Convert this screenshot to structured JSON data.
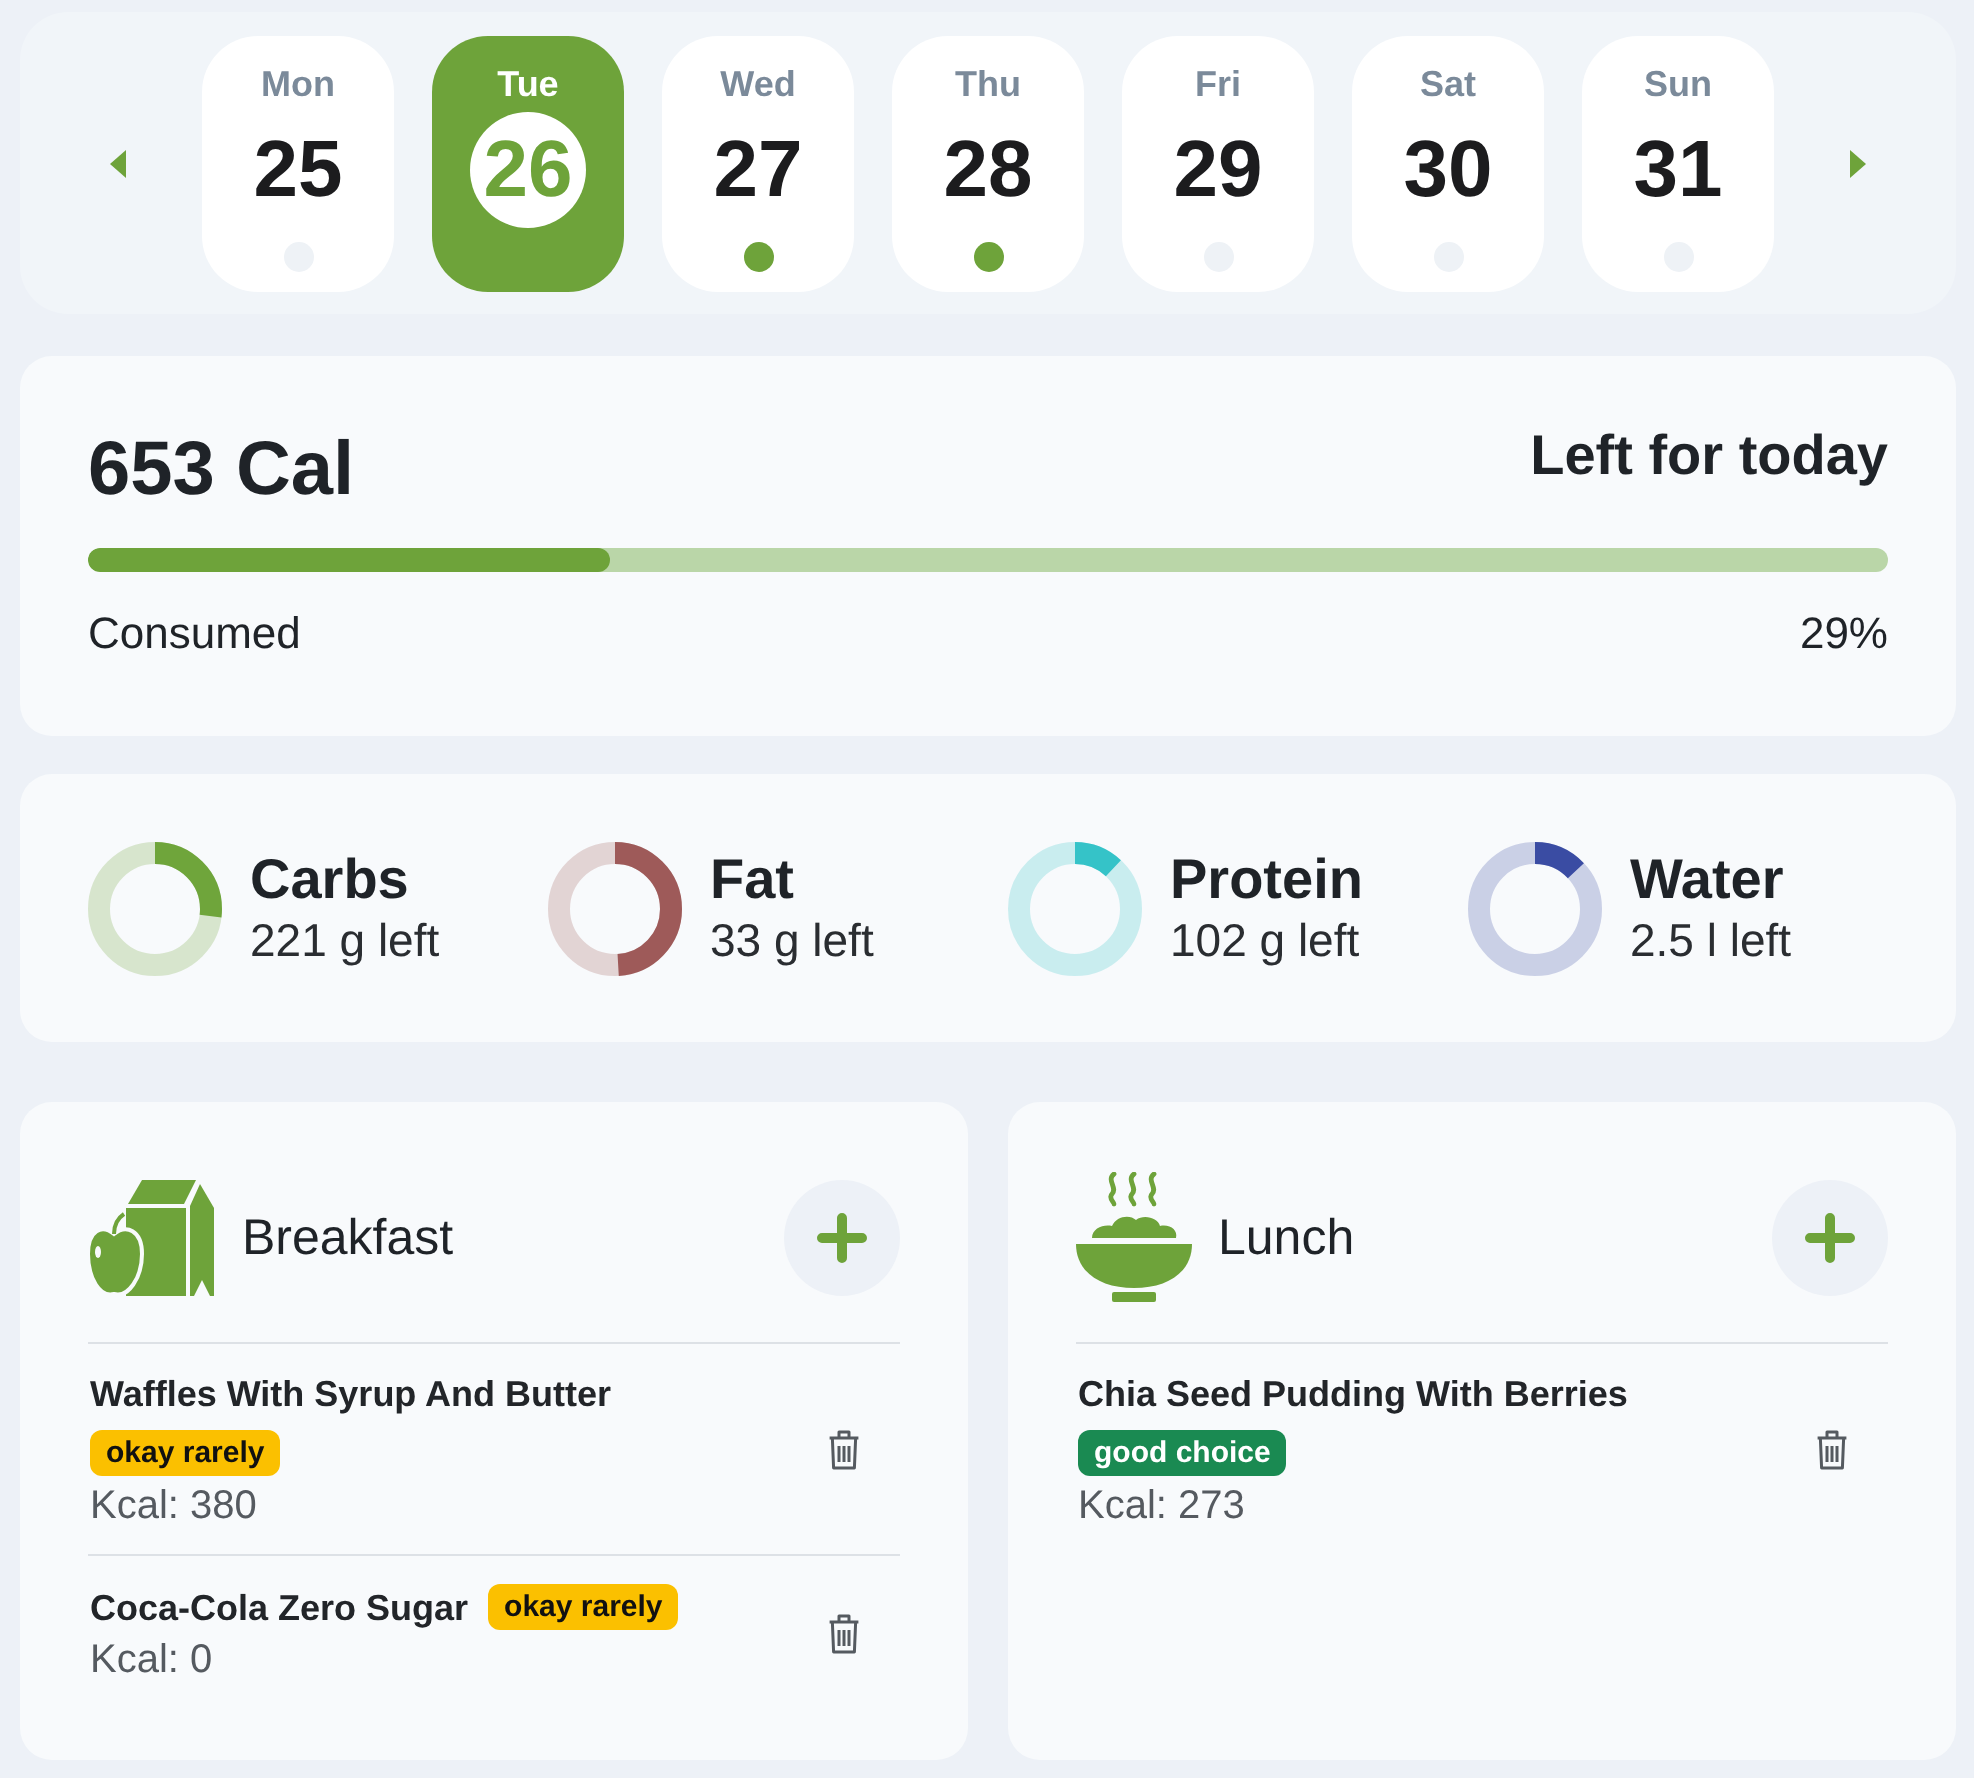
{
  "week": {
    "days": [
      {
        "weekday": "Mon",
        "date": "25",
        "selected": false,
        "logged": false
      },
      {
        "weekday": "Tue",
        "date": "26",
        "selected": true,
        "logged": false
      },
      {
        "weekday": "Wed",
        "date": "27",
        "selected": false,
        "logged": true
      },
      {
        "weekday": "Thu",
        "date": "28",
        "selected": false,
        "logged": true
      },
      {
        "weekday": "Fri",
        "date": "29",
        "selected": false,
        "logged": false
      },
      {
        "weekday": "Sat",
        "date": "30",
        "selected": false,
        "logged": false
      },
      {
        "weekday": "Sun",
        "date": "31",
        "selected": false,
        "logged": false
      }
    ]
  },
  "calories": {
    "value": "653 Cal",
    "caption": "Left for today",
    "level": 0.29,
    "progress_label": "Consumed",
    "percent": "29%"
  },
  "macros": [
    {
      "name": "Carbs",
      "remaining": "221 g left",
      "level": 0.27,
      "color": "#6fa53b"
    },
    {
      "name": "Fat",
      "remaining": "33 g left",
      "level": 0.49,
      "color": "#9e5a59"
    },
    {
      "name": "Protein",
      "remaining": "102 g left",
      "level": 0.12,
      "color": "#35c3c8"
    },
    {
      "name": "Water",
      "remaining": "2.5 l left",
      "level": 0.13,
      "color": "#3a4ca3"
    }
  ],
  "meals": [
    {
      "kind": "breakfast",
      "title": "Breakfast",
      "items": [
        {
          "name": "Waffles With Syrup And Butter",
          "tag": {
            "label": "okay rarely",
            "color": "#fbc000"
          },
          "kcal": "Kcal: 380"
        },
        {
          "name": "Coca-Cola Zero Sugar",
          "tag": {
            "label": "okay rarely",
            "color": "#fbc000"
          },
          "kcal": "Kcal: 0"
        }
      ]
    },
    {
      "kind": "lunch",
      "title": "Lunch",
      "items": [
        {
          "name": "Chia Seed Pudding With Berries",
          "tag": {
            "label": "good choice",
            "color": "#1a8a52"
          },
          "kcal": "Kcal: 273"
        }
      ]
    }
  ]
}
